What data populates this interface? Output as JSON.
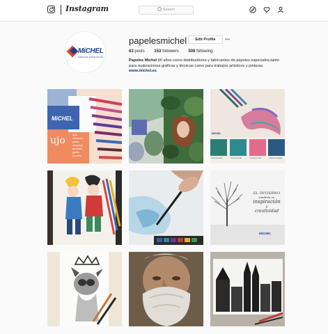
{
  "topbar": {
    "brand": "Instagram",
    "search_placeholder": "Search"
  },
  "icons": {
    "logo": "instagram-camera-icon",
    "explore": "compass-icon",
    "activity": "heart-icon",
    "profile": "person-icon"
  },
  "profile": {
    "username": "papelesmichel",
    "edit_label": "Edit Profile",
    "more_label": "•••",
    "avatar_brand": "MiCHEL",
    "avatar_sub": "PAPELES ESPECIALES",
    "stats": {
      "posts_count": "63",
      "posts_label": "posts",
      "followers_count": "153",
      "followers_label": "followers",
      "following_count": "506",
      "following_label": "following"
    },
    "bio": {
      "name": "Papeles Michel",
      "text": "90 años como distribuidores y fabricantes de papeles especiales,tanto para realizaciones gráficas y técnicas como para trabajos artísticos y pinturas.",
      "link": "www.michel.es"
    }
  },
  "posts": {
    "p1": {
      "card_brand": "MiCHEL",
      "card_word": "ujo",
      "lines": [
        "lapo",
        "rotulación",
        "pastel",
        "sanguina",
        "acuarela",
        "grafito",
        "pinceles"
      ]
    },
    "p3": {
      "swatches": [
        "Técnica lineal",
        "Técnica lineal",
        "Técnica mixta",
        "Técnica del lápiz"
      ],
      "brand": "MiCHEL"
    },
    "p6": {
      "line1": "EL INVIERNO",
      "line2": "también es",
      "line3": "inspiración",
      "line4": "y",
      "line5": "creatividad",
      "brand": "MiCHEL"
    }
  }
}
